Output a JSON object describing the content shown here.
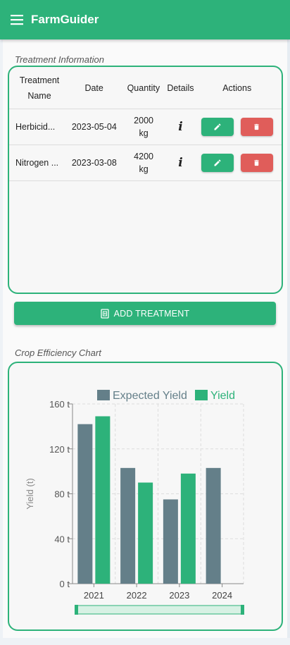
{
  "app": {
    "title": "FarmGuider",
    "menu_icon": "hamburger-icon"
  },
  "treatment_section": {
    "title": "Treatment Information",
    "columns": [
      "Treatment\nName",
      "Date",
      "Quantity",
      "Details",
      "Actions"
    ],
    "rows": [
      {
        "name": "Herbicide",
        "name_display": "Herbicid...",
        "date": "2023-05-04",
        "quantity": "2000\nkg",
        "details_icon": "info-icon"
      },
      {
        "name": "Nitrogen",
        "name_display": "Nitrogen ...",
        "date": "2023-03-08",
        "quantity": "4200\nkg",
        "details_icon": "info-icon"
      }
    ],
    "add_button": "ADD TREATMENT"
  },
  "colors": {
    "brand": "#2db27a",
    "danger": "#e05d5a",
    "expected": "#647f89",
    "yield": "#2db27a"
  },
  "chart_section": {
    "title": "Crop Efficiency Chart"
  },
  "chart_data": {
    "type": "bar",
    "categories": [
      "2021",
      "2022",
      "2023",
      "2024"
    ],
    "series": [
      {
        "name": "Expected Yield",
        "values": [
          142,
          103,
          75,
          103
        ]
      },
      {
        "name": "Yield",
        "values": [
          149,
          90,
          98,
          null
        ]
      }
    ],
    "ylabel": "Yield (t)",
    "ylim": [
      0,
      160
    ],
    "yticks": [
      "0 t",
      "40 t",
      "80 t",
      "120 t",
      "160 t"
    ],
    "grid": true,
    "legend": "top-center"
  }
}
